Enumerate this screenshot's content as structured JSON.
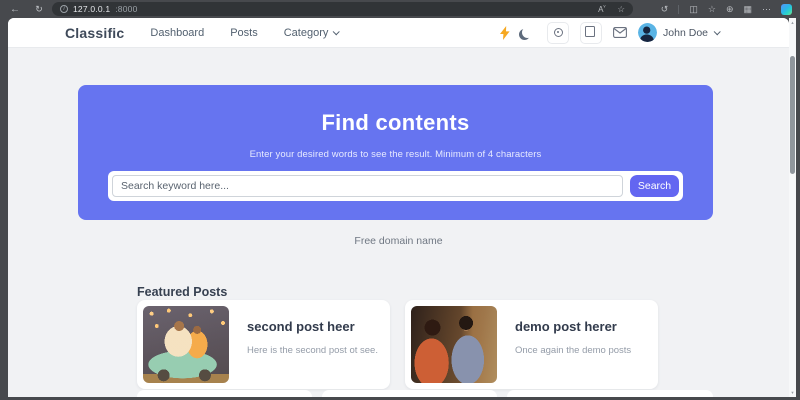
{
  "browser": {
    "url": {
      "host": "127.0.0.1",
      "port": ":8000"
    },
    "back_icon": "←",
    "refresh_icon": "↻",
    "info_glyph": "i",
    "read_aloud_icon": "A",
    "favorite_icon": "☆",
    "toolbar_icons": [
      {
        "name": "history-icon",
        "glyph": "↺"
      },
      {
        "name": "split-screen-icon",
        "glyph": "◫"
      },
      {
        "name": "collections-icon",
        "glyph": "☆"
      },
      {
        "name": "browser-essentials-icon",
        "glyph": "⊕"
      },
      {
        "name": "extensions-icon",
        "glyph": "▦"
      },
      {
        "name": "more-icon",
        "glyph": "⋯"
      }
    ],
    "scroll_up_icon": "▲",
    "scroll_down_icon": "▼"
  },
  "navbar": {
    "brand": "Classific",
    "items": [
      {
        "label": "Dashboard"
      },
      {
        "label": "Posts"
      },
      {
        "label": "Category"
      }
    ],
    "user_name": "John Doe"
  },
  "hero": {
    "title": "Find contents",
    "subtitle": "Enter your desired words to see the result. Minimum of 4 characters",
    "search_placeholder": "Search keyword here...",
    "search_button_label": "Search"
  },
  "promo_text": "Free domain name",
  "featured": {
    "heading": "Featured Posts",
    "posts": [
      {
        "title": "second post heer",
        "description": "Here is the second post ot see."
      },
      {
        "title": "demo post herer",
        "description": "Once again the demo posts"
      }
    ]
  },
  "colors": {
    "hero_bg": "#6674f0",
    "search_button": "#6366f1",
    "bolt": "#f6a821",
    "page_bg": "#f1f2f4",
    "frame": "#47494d"
  }
}
